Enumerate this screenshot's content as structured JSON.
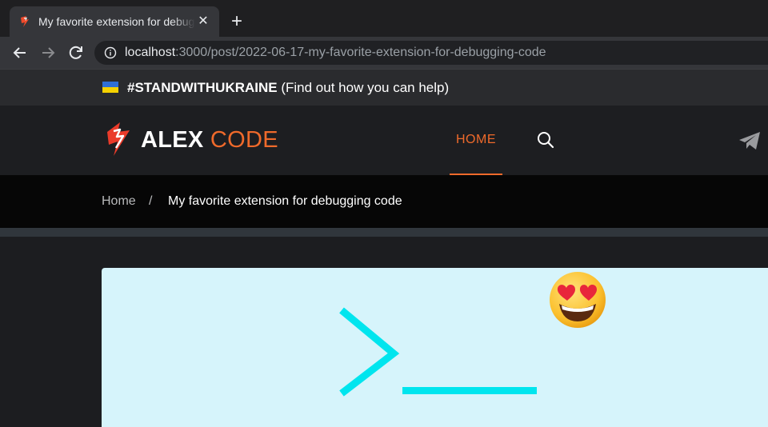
{
  "browser": {
    "tab_title": "My favorite extension for debugging code",
    "tab_close": "✕",
    "new_tab": "+",
    "url_host": "localhost",
    "url_rest": ":3000/post/2022-06-17-my-favorite-extension-for-debugging-code"
  },
  "banner": {
    "hashtag": "#STANDWITHUKRAINE",
    "text": " (Find out how you can help)",
    "flag_colors": [
      "#2f6fd6",
      "#f5d100"
    ]
  },
  "site": {
    "logo_alex": "ALEX",
    "logo_code": "CODE",
    "nav_home": "HOME",
    "accent_color": "#ef6a2b"
  },
  "breadcrumb": {
    "home": "Home",
    "separator": "/",
    "current": "My favorite extension for debugging code"
  },
  "hero": {
    "background": "#d6f4fb",
    "prompt_color": "#00e5ee",
    "emoji": "smiling-face-with-heart-eyes"
  },
  "icons": [
    "favicon-icon",
    "back-arrow-icon",
    "forward-arrow-icon",
    "reload-icon",
    "info-icon",
    "search-icon",
    "telegram-icon",
    "heart-eyes-emoji-icon"
  ]
}
